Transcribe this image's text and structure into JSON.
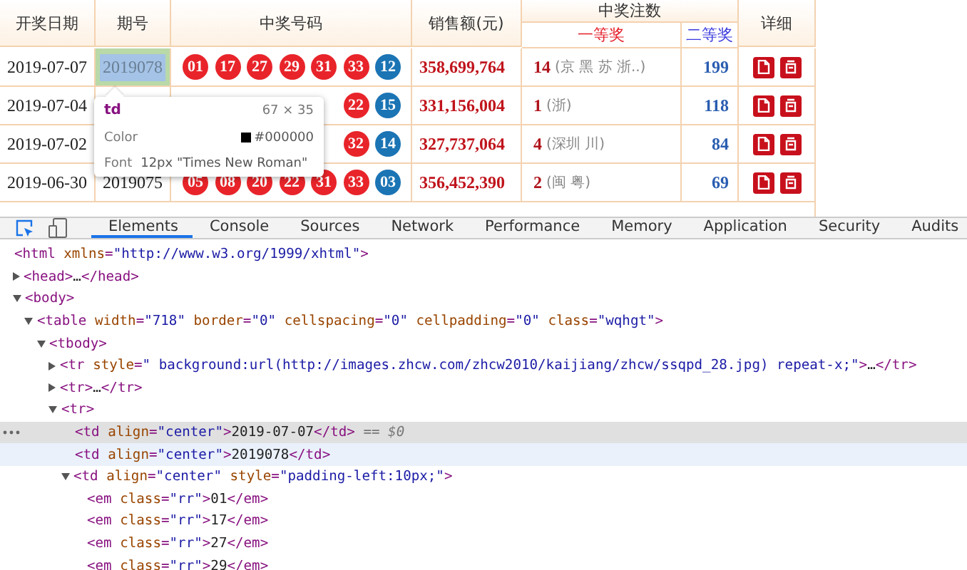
{
  "lottery_table": {
    "headers": {
      "date": "开奖日期",
      "issue": "期号",
      "numbers": "中奖号码",
      "sales": "销售额(元)",
      "winners": "中奖注数",
      "first_prize": "一等奖",
      "second_prize": "二等奖",
      "detail": "详细"
    },
    "rows": [
      {
        "date": "2019-07-07",
        "issue": "2019078",
        "issue_highlighted": true,
        "balls": [
          {
            "n": "01",
            "color": "#e8242a"
          },
          {
            "n": "17",
            "color": "#e8242a"
          },
          {
            "n": "27",
            "color": "#e8242a"
          },
          {
            "n": "29",
            "color": "#e8242a"
          },
          {
            "n": "31",
            "color": "#e8242a"
          },
          {
            "n": "33",
            "color": "#e8242a"
          },
          {
            "n": "12",
            "color": "#1b74b4"
          }
        ],
        "sales": "358,699,764",
        "first_count": "14",
        "first_regions": "(京 黑 苏 浙..)",
        "second_count": "199"
      },
      {
        "date": "2019-07-04",
        "balls": [
          {
            "n": "22",
            "color": "#e8242a"
          },
          {
            "n": "15",
            "color": "#1b74b4"
          }
        ],
        "sales": "331,156,004",
        "first_count": "1",
        "first_regions": "(浙)",
        "second_count": "118"
      },
      {
        "date": "2019-07-02",
        "balls": [
          {
            "n": "32",
            "color": "#e8242a"
          },
          {
            "n": "14",
            "color": "#1b74b4"
          }
        ],
        "sales": "327,737,064",
        "first_count": "4",
        "first_regions": "(深圳 川)",
        "second_count": "84"
      },
      {
        "date": "2019-06-30",
        "issue": "2019075",
        "issue_highlighted": false,
        "balls": [
          {
            "n": "05",
            "color": "#e8242a"
          },
          {
            "n": "08",
            "color": "#e8242a"
          },
          {
            "n": "20",
            "color": "#e8242a"
          },
          {
            "n": "22",
            "color": "#e8242a"
          },
          {
            "n": "31",
            "color": "#e8242a"
          },
          {
            "n": "33",
            "color": "#e8242a"
          },
          {
            "n": "03",
            "color": "#1b74b4"
          }
        ],
        "sales": "356,452,390",
        "first_count": "2",
        "first_regions": "(闽 粤)",
        "second_count": "69"
      }
    ]
  },
  "inspect_tooltip": {
    "tag": "td",
    "size": "67 × 35",
    "color_label": "Color",
    "color_value": "#000000",
    "font_label": "Font",
    "font_value": "12px \"Times New Roman\""
  },
  "devtools": {
    "tabs": [
      {
        "label": "Elements",
        "selected": true
      },
      {
        "label": "Console",
        "selected": false
      },
      {
        "label": "Sources",
        "selected": false
      },
      {
        "label": "Network",
        "selected": false
      },
      {
        "label": "Performance",
        "selected": false
      },
      {
        "label": "Memory",
        "selected": false
      },
      {
        "label": "Application",
        "selected": false
      },
      {
        "label": "Security",
        "selected": false
      },
      {
        "label": "Audits",
        "selected": false
      }
    ],
    "dom_tree": [
      {
        "selected": false,
        "hovered": false,
        "parts": [
          {
            "kind": "tag",
            "text": "<html "
          },
          {
            "kind": "attr",
            "text": "xmlns"
          },
          {
            "kind": "tag",
            "text": "="
          },
          {
            "kind": "value",
            "text": "\"http://www.w3.org/1999/xhtml\""
          },
          {
            "kind": "tag",
            "text": ">"
          }
        ],
        "children": [
          {
            "selected": false,
            "hovered": false,
            "expanded": false,
            "parts": [
              {
                "kind": "tag",
                "text": "<head>"
              },
              {
                "kind": "text",
                "text": "…"
              },
              {
                "kind": "tag",
                "text": "</head>"
              }
            ]
          },
          {
            "selected": false,
            "hovered": false,
            "expanded": true,
            "parts": [
              {
                "kind": "tag",
                "text": "<body>"
              }
            ],
            "children": [
              {
                "selected": false,
                "hovered": false,
                "expanded": true,
                "parts": [
                  {
                    "kind": "tag",
                    "text": "<table "
                  },
                  {
                    "kind": "attr",
                    "text": "width"
                  },
                  {
                    "kind": "tag",
                    "text": "="
                  },
                  {
                    "kind": "value",
                    "text": "\"718\" "
                  },
                  {
                    "kind": "attr",
                    "text": "border"
                  },
                  {
                    "kind": "tag",
                    "text": "="
                  },
                  {
                    "kind": "value",
                    "text": "\"0\" "
                  },
                  {
                    "kind": "attr",
                    "text": "cellspacing"
                  },
                  {
                    "kind": "tag",
                    "text": "="
                  },
                  {
                    "kind": "value",
                    "text": "\"0\" "
                  },
                  {
                    "kind": "attr",
                    "text": "cellpadding"
                  },
                  {
                    "kind": "tag",
                    "text": "="
                  },
                  {
                    "kind": "value",
                    "text": "\"0\" "
                  },
                  {
                    "kind": "attr",
                    "text": "class"
                  },
                  {
                    "kind": "tag",
                    "text": "="
                  },
                  {
                    "kind": "value",
                    "text": "\"wqhgt\""
                  },
                  {
                    "kind": "tag",
                    "text": ">"
                  }
                ],
                "children": [
                  {
                    "selected": false,
                    "hovered": false,
                    "expanded": true,
                    "parts": [
                      {
                        "kind": "tag",
                        "text": "<tbody>"
                      }
                    ],
                    "children": [
                      {
                        "selected": false,
                        "hovered": false,
                        "expanded": false,
                        "parts": [
                          {
                            "kind": "tag",
                            "text": "<tr "
                          },
                          {
                            "kind": "attr",
                            "text": "style"
                          },
                          {
                            "kind": "tag",
                            "text": "="
                          },
                          {
                            "kind": "value",
                            "text": "\" background:url(http://images.zhcw.com/zhcw2010/kaijiang/zhcw/ssqpd_28.jpg) repeat-x;\""
                          },
                          {
                            "kind": "tag",
                            "text": ">"
                          },
                          {
                            "kind": "text",
                            "text": "…"
                          },
                          {
                            "kind": "tag",
                            "text": "</tr>"
                          }
                        ]
                      },
                      {
                        "selected": false,
                        "hovered": false,
                        "expanded": false,
                        "parts": [
                          {
                            "kind": "tag",
                            "text": "<tr>"
                          },
                          {
                            "kind": "text",
                            "text": "…"
                          },
                          {
                            "kind": "tag",
                            "text": "</tr>"
                          }
                        ]
                      },
                      {
                        "selected": false,
                        "hovered": false,
                        "expanded": true,
                        "parts": [
                          {
                            "kind": "tag",
                            "text": "<tr>"
                          }
                        ],
                        "children": [
                          {
                            "selected": true,
                            "hovered": false,
                            "parts": [
                              {
                                "kind": "tag",
                                "text": "<td "
                              },
                              {
                                "kind": "attr",
                                "text": "align"
                              },
                              {
                                "kind": "tag",
                                "text": "="
                              },
                              {
                                "kind": "value",
                                "text": "\"center\""
                              },
                              {
                                "kind": "tag",
                                "text": ">"
                              },
                              {
                                "kind": "text",
                                "text": "2019-07-07"
                              },
                              {
                                "kind": "tag",
                                "text": "</td>"
                              },
                              {
                                "kind": "hint",
                                "text": " == $0"
                              }
                            ]
                          },
                          {
                            "selected": false,
                            "hovered": true,
                            "parts": [
                              {
                                "kind": "tag",
                                "text": "<td "
                              },
                              {
                                "kind": "attr",
                                "text": "align"
                              },
                              {
                                "kind": "tag",
                                "text": "="
                              },
                              {
                                "kind": "value",
                                "text": "\"center\""
                              },
                              {
                                "kind": "tag",
                                "text": ">"
                              },
                              {
                                "kind": "text",
                                "text": "2019078"
                              },
                              {
                                "kind": "tag",
                                "text": "</td>"
                              }
                            ]
                          },
                          {
                            "selected": false,
                            "hovered": false,
                            "expanded": true,
                            "parts": [
                              {
                                "kind": "tag",
                                "text": "<td "
                              },
                              {
                                "kind": "attr",
                                "text": "align"
                              },
                              {
                                "kind": "tag",
                                "text": "="
                              },
                              {
                                "kind": "value",
                                "text": "\"center\" "
                              },
                              {
                                "kind": "attr",
                                "text": "style"
                              },
                              {
                                "kind": "tag",
                                "text": "="
                              },
                              {
                                "kind": "value",
                                "text": "\"padding-left:10px;\""
                              },
                              {
                                "kind": "tag",
                                "text": ">"
                              }
                            ],
                            "children": [
                              {
                                "selected": false,
                                "hovered": false,
                                "parts": [
                                  {
                                    "kind": "tag",
                                    "text": "<em "
                                  },
                                  {
                                    "kind": "attr",
                                    "text": "class"
                                  },
                                  {
                                    "kind": "tag",
                                    "text": "="
                                  },
                                  {
                                    "kind": "value",
                                    "text": "\"rr\""
                                  },
                                  {
                                    "kind": "tag",
                                    "text": ">"
                                  },
                                  {
                                    "kind": "text",
                                    "text": "01"
                                  },
                                  {
                                    "kind": "tag",
                                    "text": "</em>"
                                  }
                                ]
                              },
                              {
                                "selected": false,
                                "hovered": false,
                                "parts": [
                                  {
                                    "kind": "tag",
                                    "text": "<em "
                                  },
                                  {
                                    "kind": "attr",
                                    "text": "class"
                                  },
                                  {
                                    "kind": "tag",
                                    "text": "="
                                  },
                                  {
                                    "kind": "value",
                                    "text": "\"rr\""
                                  },
                                  {
                                    "kind": "tag",
                                    "text": ">"
                                  },
                                  {
                                    "kind": "text",
                                    "text": "17"
                                  },
                                  {
                                    "kind": "tag",
                                    "text": "</em>"
                                  }
                                ]
                              },
                              {
                                "selected": false,
                                "hovered": false,
                                "parts": [
                                  {
                                    "kind": "tag",
                                    "text": "<em "
                                  },
                                  {
                                    "kind": "attr",
                                    "text": "class"
                                  },
                                  {
                                    "kind": "tag",
                                    "text": "="
                                  },
                                  {
                                    "kind": "value",
                                    "text": "\"rr\""
                                  },
                                  {
                                    "kind": "tag",
                                    "text": ">"
                                  },
                                  {
                                    "kind": "text",
                                    "text": "27"
                                  },
                                  {
                                    "kind": "tag",
                                    "text": "</em>"
                                  }
                                ]
                              },
                              {
                                "selected": false,
                                "hovered": false,
                                "parts": [
                                  {
                                    "kind": "tag",
                                    "text": "<em "
                                  },
                                  {
                                    "kind": "attr",
                                    "text": "class"
                                  },
                                  {
                                    "kind": "tag",
                                    "text": "="
                                  },
                                  {
                                    "kind": "value",
                                    "text": "\"rr\""
                                  },
                                  {
                                    "kind": "tag",
                                    "text": ">"
                                  },
                                  {
                                    "kind": "text",
                                    "text": "29"
                                  },
                                  {
                                    "kind": "tag",
                                    "text": "</em>"
                                  }
                                ]
                              }
                            ]
                          }
                        ]
                      }
                    ]
                  }
                ]
              }
            ]
          }
        ]
      }
    ]
  }
}
